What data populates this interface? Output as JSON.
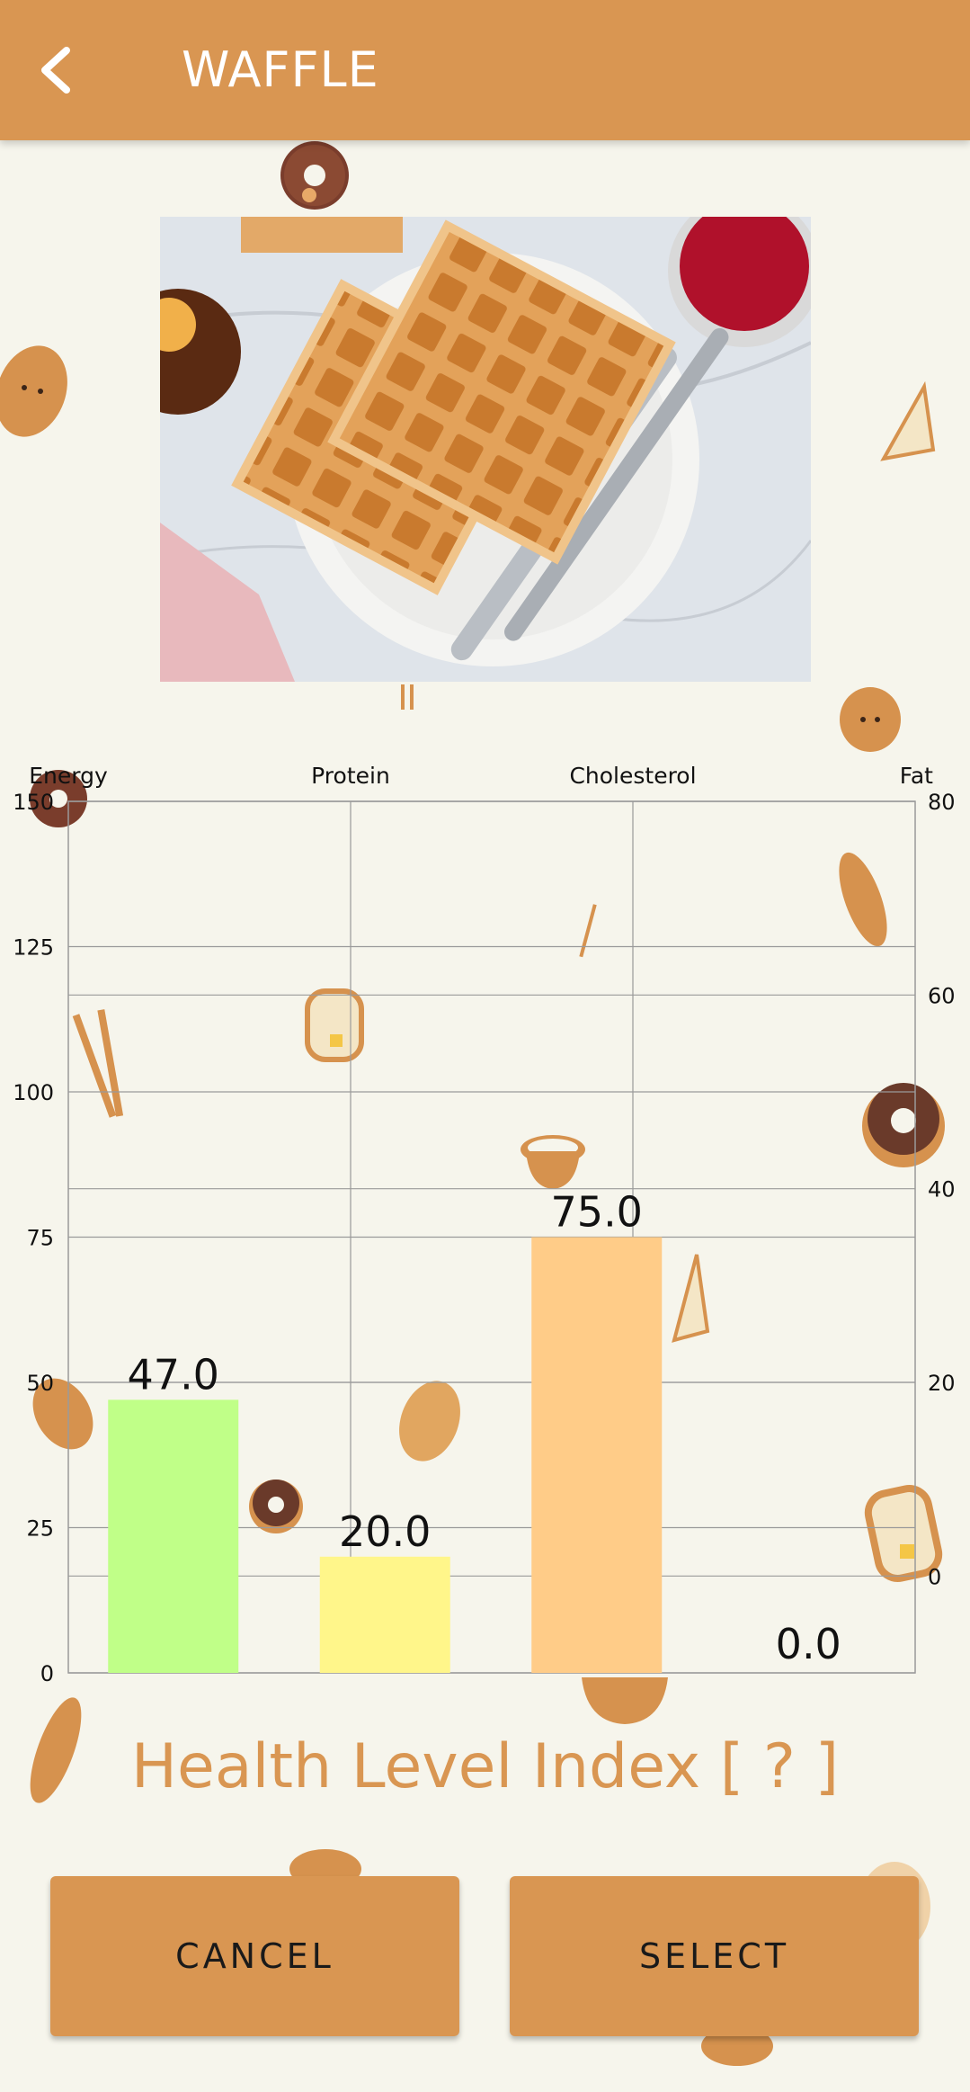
{
  "app_bar": {
    "title": "WAFFLE",
    "back_icon": "chevron-left-icon"
  },
  "food_image": {
    "description_icon": "waffle-photo"
  },
  "chart_data": {
    "type": "bar",
    "categories": [
      "Energy",
      "Protein",
      "Cholesterol",
      "Fat"
    ],
    "values": [
      47.0,
      20.0,
      75.0,
      0.0
    ],
    "value_labels": [
      "47.0",
      "20.0",
      "75.0",
      "0.0"
    ],
    "colors": [
      "#c0ff88",
      "#fff68a",
      "#ffcc88",
      "#f0a050"
    ],
    "left_axis": {
      "ylim": [
        0,
        150
      ],
      "ticks": [
        "0",
        "25",
        "50",
        "75",
        "100",
        "125",
        "150"
      ]
    },
    "right_axis": {
      "ylim": [
        -10,
        80
      ],
      "ticks": [
        "0",
        "20",
        "40",
        "60",
        "80"
      ]
    },
    "grid": true,
    "legend": "none"
  },
  "health_index": {
    "label": "Health Level Index [ ? ]"
  },
  "actions": {
    "cancel_label": "CANCEL",
    "select_label": "SELECT"
  },
  "colors": {
    "primary": "#d99652",
    "background": "#f6f5ec",
    "decor_brown": "#d6924e",
    "decor_dark": "#6a3a2a"
  }
}
